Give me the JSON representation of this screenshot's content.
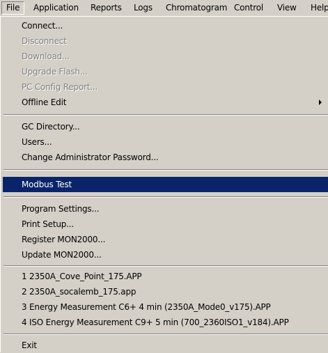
{
  "menubar": {
    "items": [
      {
        "label": "File"
      },
      {
        "label": "Application"
      },
      {
        "label": "Reports"
      },
      {
        "label": "Logs"
      },
      {
        "label": "Chromatogram"
      },
      {
        "label": "Control"
      },
      {
        "label": "View"
      },
      {
        "label": "Help"
      }
    ]
  },
  "file_menu": {
    "connect": "Connect...",
    "disconnect": "Disconnect",
    "download": "Download...",
    "upgrade_flash": "Upgrade Flash...",
    "pc_config_report": "PC Config Report...",
    "offline_edit": "Offline Edit",
    "gc_directory": "GC Directory...",
    "users": "Users...",
    "change_admin_password": "Change Administrator Password...",
    "modbus_test": "Modbus Test",
    "program_settings": "Program Settings...",
    "print_setup": "Print Setup...",
    "register": "Register MON2000...",
    "update": "Update MON2000...",
    "recent_files": [
      "1 2350A_Cove_Point_175.APP",
      "2 2350A_socalemb_175.app",
      "3 Energy Measurement C6+ 4 min (2350A_Mode0_v175).APP",
      "4 ISO Energy Measurement C9+ 5 min (700_2360ISO1_v184).APP"
    ],
    "exit": "Exit"
  },
  "colors": {
    "menu_bg": "#d4d0c8",
    "highlight_bg": "#0a246a",
    "highlight_text": "#ffffff",
    "disabled_text": "#808080"
  }
}
